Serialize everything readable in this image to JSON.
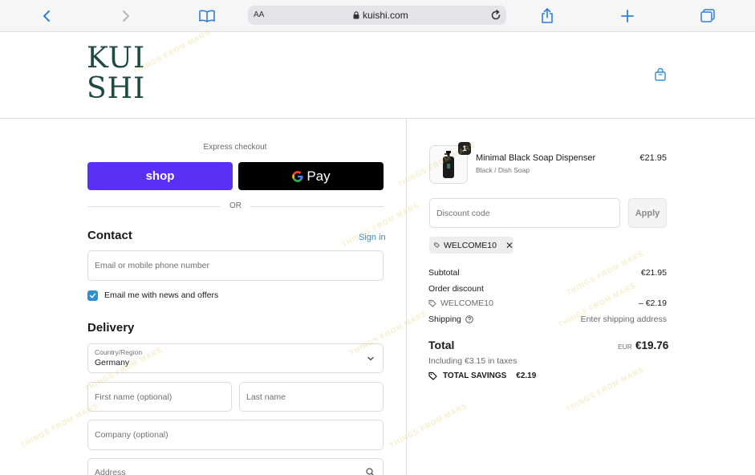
{
  "browser": {
    "text_size_label": "AA",
    "url": "kuishi.com"
  },
  "header": {
    "logo_line1": "KUI",
    "logo_line2": "SHI"
  },
  "express": {
    "label": "Express checkout",
    "shop_pay_label": "shop",
    "gpay_label": "Pay",
    "separator": "OR"
  },
  "contact": {
    "title": "Contact",
    "signin_label": "Sign in",
    "email_placeholder": "Email or mobile phone number",
    "newsletter_label": "Email me with news and offers",
    "newsletter_checked": true
  },
  "delivery": {
    "title": "Delivery",
    "country_label": "Country/Region",
    "country_value": "Germany",
    "first_name_placeholder": "First name (optional)",
    "last_name_placeholder": "Last name",
    "company_placeholder": "Company (optional)",
    "address_placeholder": "Address"
  },
  "order": {
    "item": {
      "name": "Minimal Black Soap Dispenser",
      "variant": "Black / Dish Soap",
      "price": "€21.95",
      "quantity": "1"
    },
    "discount_placeholder": "Discount code",
    "apply_label": "Apply",
    "applied_code": "WELCOME10",
    "subtotal_label": "Subtotal",
    "subtotal_value": "€21.95",
    "order_discount_label": "Order discount",
    "order_discount_code": "WELCOME10",
    "order_discount_value": "– €2.19",
    "shipping_label": "Shipping",
    "shipping_value": "Enter shipping address",
    "total_label": "Total",
    "total_currency": "EUR",
    "total_value": "€19.76",
    "tax_line": "Including €3.15 in taxes",
    "savings_label": "TOTAL SAVINGS",
    "savings_value": "€2.19"
  },
  "watermark_text": "THINGS FROM MARS",
  "colors": {
    "brand_green": "#1f4a3f",
    "shop_pay": "#5a31f4",
    "link_blue": "#2e8fd1"
  }
}
